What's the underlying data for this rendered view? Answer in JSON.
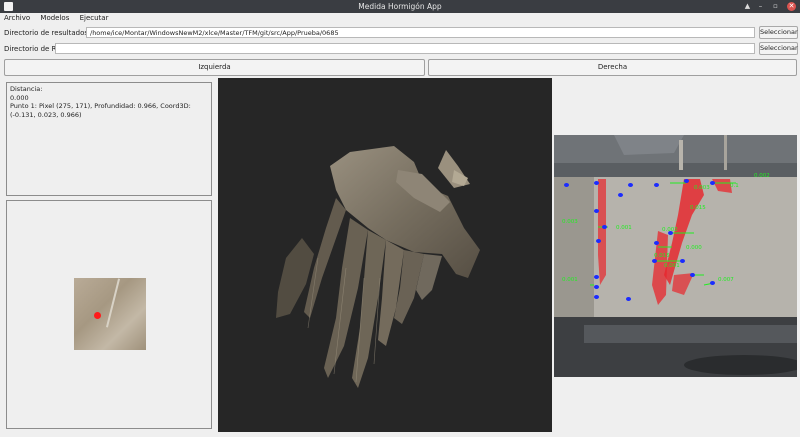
{
  "window": {
    "title": "Medida Hormigón App",
    "controls": [
      "▲",
      "–",
      "▫",
      "✕"
    ]
  },
  "menu": [
    "Archivo",
    "Modelos",
    "Ejecutar"
  ],
  "results_dir": {
    "label": "Directorio de resultados:",
    "value": "/home/ice/Montar/WindowsNewM2/xlce/Master/TFM/git/src/App/Prueba/0685",
    "button": "Seleccionar"
  },
  "roi_dir": {
    "label": "Directorio de ROI:",
    "value": "",
    "button": "Seleccionar"
  },
  "buttons": {
    "left": "Izquierda",
    "right": "Derecha"
  },
  "info": {
    "distance_label": "Distancia:",
    "distance_value": "0.000",
    "point1": "Punto 1: Pixel (275, 171), Profundidad: 0.966, Coord3D: (-0.131, 0.023, 0.966)"
  },
  "photo_labels": [
    "0.002",
    "0.1",
    "0.003",
    "0.003",
    "0.015",
    "0.001",
    "0.002",
    "0.015",
    "0.001",
    "0.007",
    "0.001",
    "0.000"
  ],
  "colors": {
    "titlebar": "#3a3d42",
    "cloud_bg": "#262626",
    "point_marker": "#ff1a1a",
    "crack_mask": "#e8262c",
    "measure_point": "#1b2cff",
    "measure_line": "#22ee22"
  }
}
